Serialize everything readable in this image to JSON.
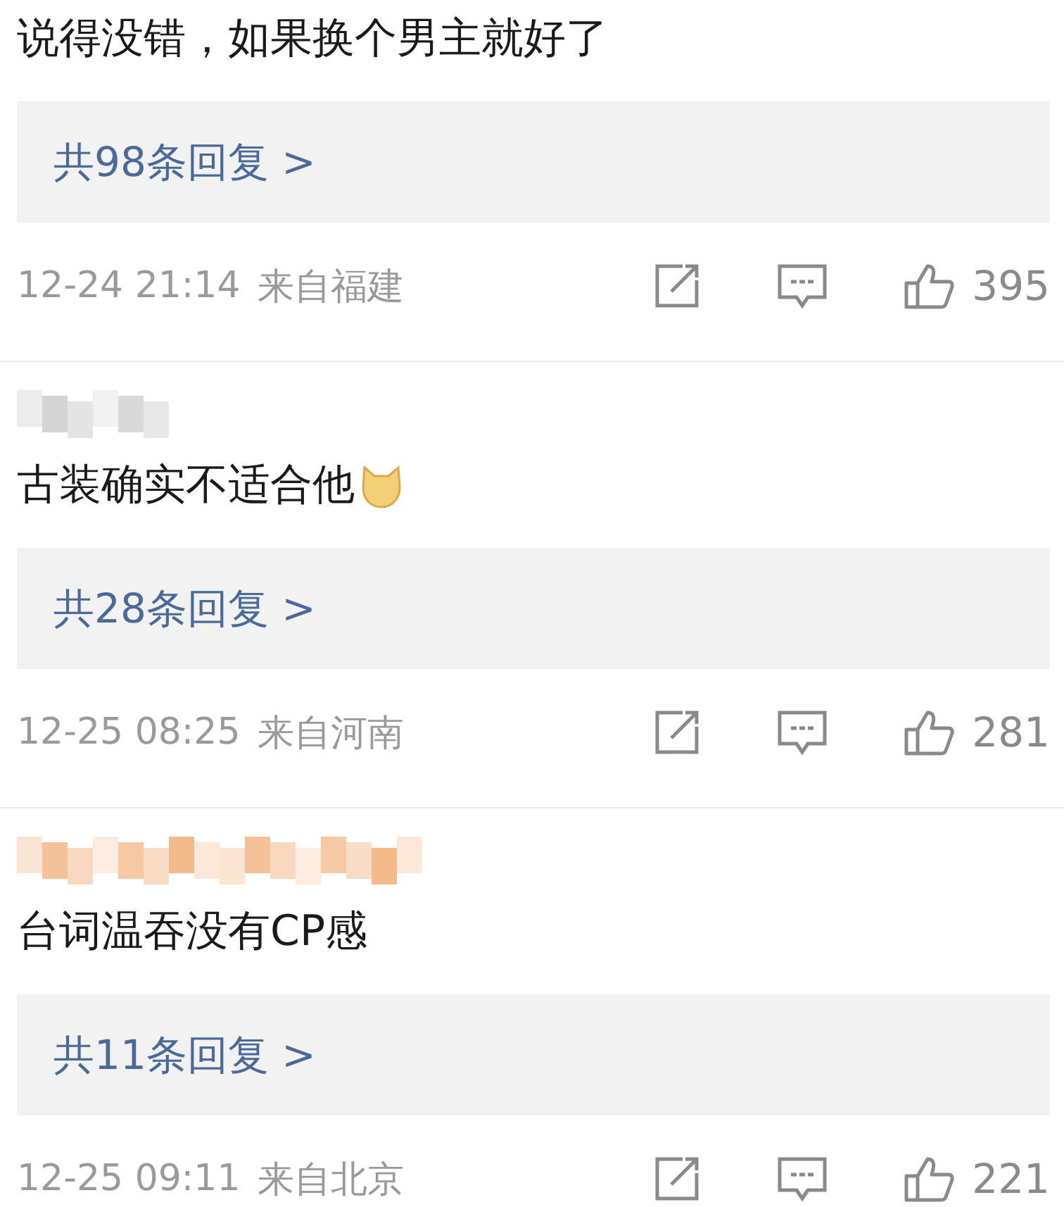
{
  "comments": [
    {
      "text": "说得没错，如果换个男主就好了",
      "emoji": false,
      "replies": "共98条回复 >",
      "time": "12-24 21:14",
      "location": "来自福建",
      "likes": "395"
    },
    {
      "author": {
        "kind": "redacted",
        "color": "#c9c9c9"
      },
      "text": "古装确实不适合他",
      "emoji": true,
      "replies": "共28条回复 >",
      "time": "12-25 08:25",
      "location": "来自河南",
      "likes": "281"
    },
    {
      "author": {
        "kind": "redacted",
        "color": "#f2b27e"
      },
      "text": "台词温吞没有CP感",
      "emoji": false,
      "replies": "共11条回复 >",
      "time": "12-25 09:11",
      "location": "来自北京",
      "likes": "221"
    }
  ]
}
